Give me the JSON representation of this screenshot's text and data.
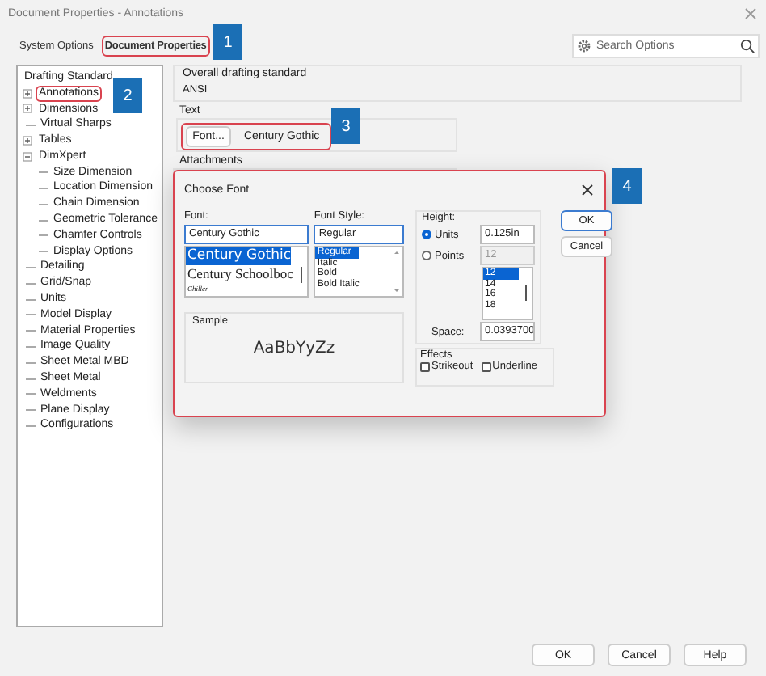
{
  "window": {
    "title": "Document Properties - Annotations"
  },
  "tabs": [
    {
      "label": "System Options",
      "selected": false,
      "highlighted": false
    },
    {
      "label": "Document Properties",
      "selected": true,
      "highlighted": true
    }
  ],
  "search": {
    "placeholder": "Search Options"
  },
  "tree": [
    {
      "label": "Drafting Standard",
      "highlighted": false
    },
    {
      "label": "Annotations",
      "expanded": false,
      "highlighted": true
    },
    {
      "label": "Dimensions",
      "expanded": false,
      "highlighted": false
    },
    {
      "label": "Virtual Sharps",
      "highlighted": false
    },
    {
      "label": "Tables",
      "expanded": false,
      "highlighted": false
    },
    {
      "label": "DimXpert",
      "expanded": true,
      "highlighted": false,
      "children": [
        {
          "label": "Size Dimension"
        },
        {
          "label": "Location Dimension"
        },
        {
          "label": "Chain Dimension"
        },
        {
          "label": "Geometric Tolerance"
        },
        {
          "label": "Chamfer Controls"
        },
        {
          "label": "Display Options"
        }
      ]
    },
    {
      "label": "Detailing",
      "highlighted": false
    },
    {
      "label": "Grid/Snap",
      "highlighted": false
    },
    {
      "label": "Units",
      "highlighted": false
    },
    {
      "label": "Model Display",
      "highlighted": false
    },
    {
      "label": "Material Properties",
      "highlighted": false
    },
    {
      "label": "Image Quality",
      "highlighted": false
    },
    {
      "label": "Sheet Metal MBD",
      "highlighted": false
    },
    {
      "label": "Sheet Metal",
      "highlighted": false
    },
    {
      "label": "Weldments",
      "highlighted": false
    },
    {
      "label": "Plane Display",
      "highlighted": false
    },
    {
      "label": "Configurations",
      "highlighted": false
    }
  ],
  "drafting_standard": {
    "label": "Overall drafting standard",
    "value": "ANSI"
  },
  "text_group": {
    "label": "Text",
    "font_button": "Font...",
    "font_name": "Century Gothic",
    "highlighted": true
  },
  "attachments": {
    "label": "Attachments"
  },
  "dialog": {
    "title": "Choose Font",
    "font": {
      "label": "Font:",
      "value": "Century Gothic",
      "options": [
        {
          "label": "Century Gothic",
          "kind": "sans",
          "selected": true
        },
        {
          "label": "Century Schoolboc",
          "kind": "serif",
          "selected": false
        },
        {
          "label": "Chiller",
          "kind": "script",
          "selected": false
        }
      ]
    },
    "font_style": {
      "label": "Font Style:",
      "value": "Regular",
      "options": [
        {
          "label": "Regular",
          "selected": true
        },
        {
          "label": "Italic",
          "selected": false
        },
        {
          "label": "Bold",
          "selected": false
        },
        {
          "label": "Bold Italic",
          "selected": false
        }
      ]
    },
    "height": {
      "label": "Height:",
      "modes": [
        {
          "label": "Units",
          "selected": true,
          "value": "0.125in"
        },
        {
          "label": "Points",
          "selected": false,
          "value": "12"
        }
      ],
      "sizes": [
        {
          "label": "12",
          "selected": true
        },
        {
          "label": "14",
          "selected": false
        },
        {
          "label": "16",
          "selected": false
        },
        {
          "label": "18",
          "selected": false
        }
      ],
      "space_label": "Space:",
      "space_value": "0.0393700"
    },
    "sample": {
      "label": "Sample",
      "text": "AaBbYyZz"
    },
    "effects": {
      "label": "Effects",
      "options": [
        {
          "label": "Strikeout",
          "checked": false
        },
        {
          "label": "Underline",
          "checked": false
        }
      ]
    },
    "buttons": [
      "OK",
      "Cancel"
    ]
  },
  "callouts": [
    "1",
    "2",
    "3",
    "4"
  ],
  "footer_buttons": [
    "OK",
    "Cancel",
    "Help"
  ]
}
